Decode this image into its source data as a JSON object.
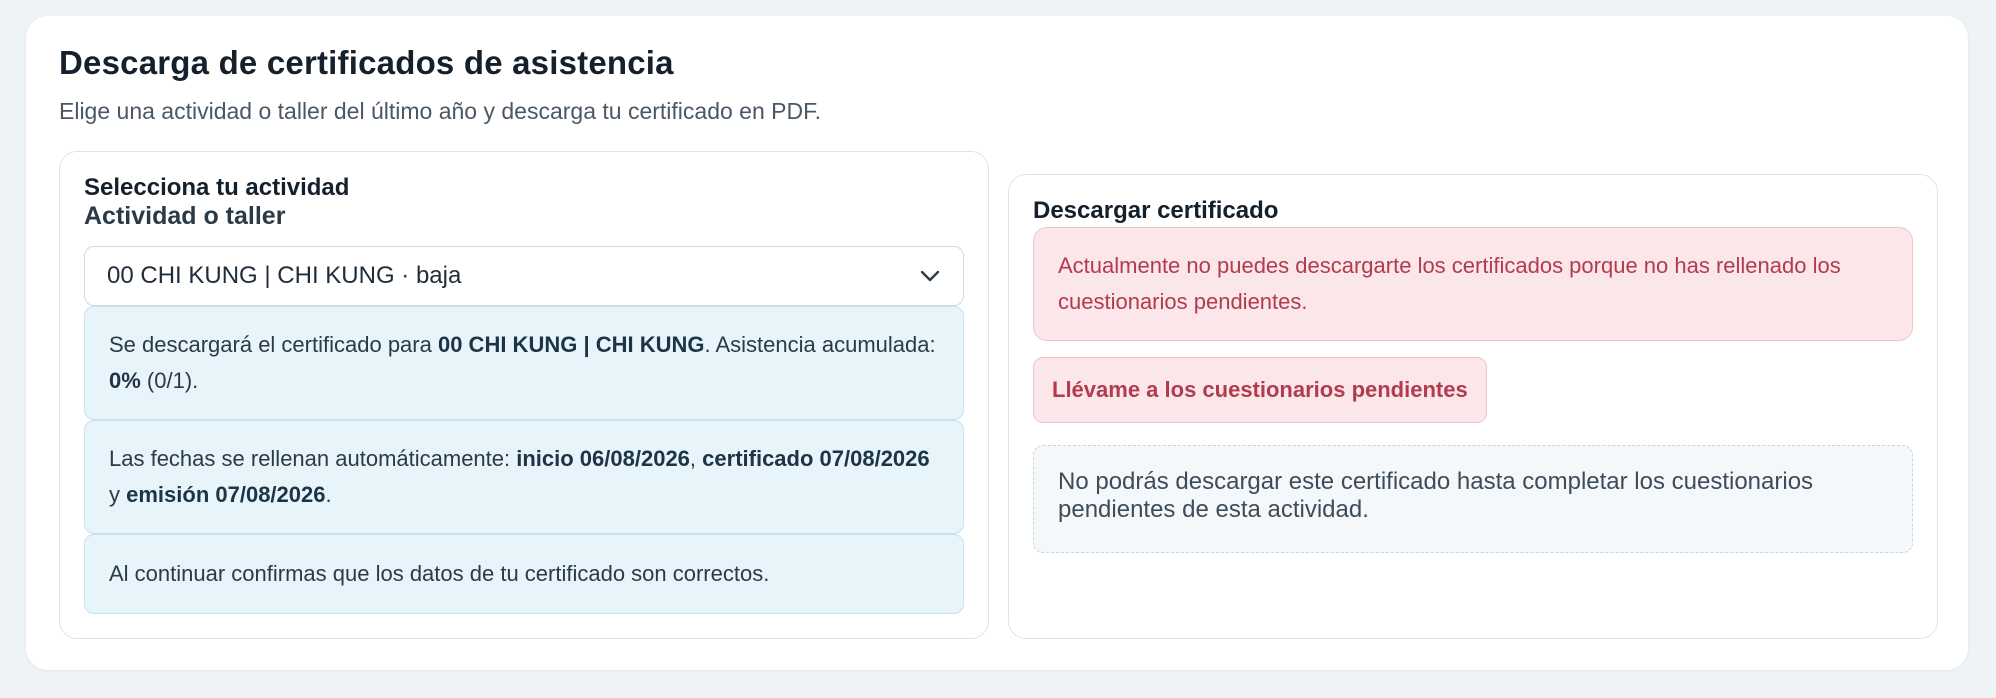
{
  "header": {
    "title": "Descarga de certificados de asistencia",
    "subtitle": "Elige una actividad o taller del último año y descarga tu certificado en PDF."
  },
  "left_panel": {
    "section_title": "Selecciona tu actividad",
    "field_label": "Actividad o taller",
    "select_value": "00 CHI KUNG | CHI KUNG · baja",
    "info1": {
      "prefix": "Se descargará el certificado para ",
      "activity": "00 CHI KUNG | CHI KUNG",
      "middle": ". Asistencia acumulada: ",
      "percent": "0%",
      "ratio": " (0/1)."
    },
    "info2": {
      "prefix": "Las fechas se rellenan automáticamente: ",
      "start": "inicio 06/08/2026",
      "sep1": ", ",
      "cert": "certificado 07/08/2026",
      "sep2": " y ",
      "emission": "emisión 07/08/2026",
      "end": "."
    },
    "info3": "Al continuar confirmas que los datos de tu certificado son correctos."
  },
  "right_panel": {
    "title": "Descargar certificado",
    "alert": "Actualmente no puedes descargarte los certificados porque no has rellenado los cuestionarios pendientes.",
    "button_label": "Llévame a los cuestionarios pendientes",
    "note": "No podrás descargar este certificado hasta completar los cuestionarios pendientes de esta actividad."
  },
  "colors": {
    "accent_info": "#e7f4fa",
    "alert_bg": "#fbe7ea",
    "alert_text": "#b23b4e"
  },
  "icons": {
    "select_chevron": "chevron-down-icon"
  }
}
